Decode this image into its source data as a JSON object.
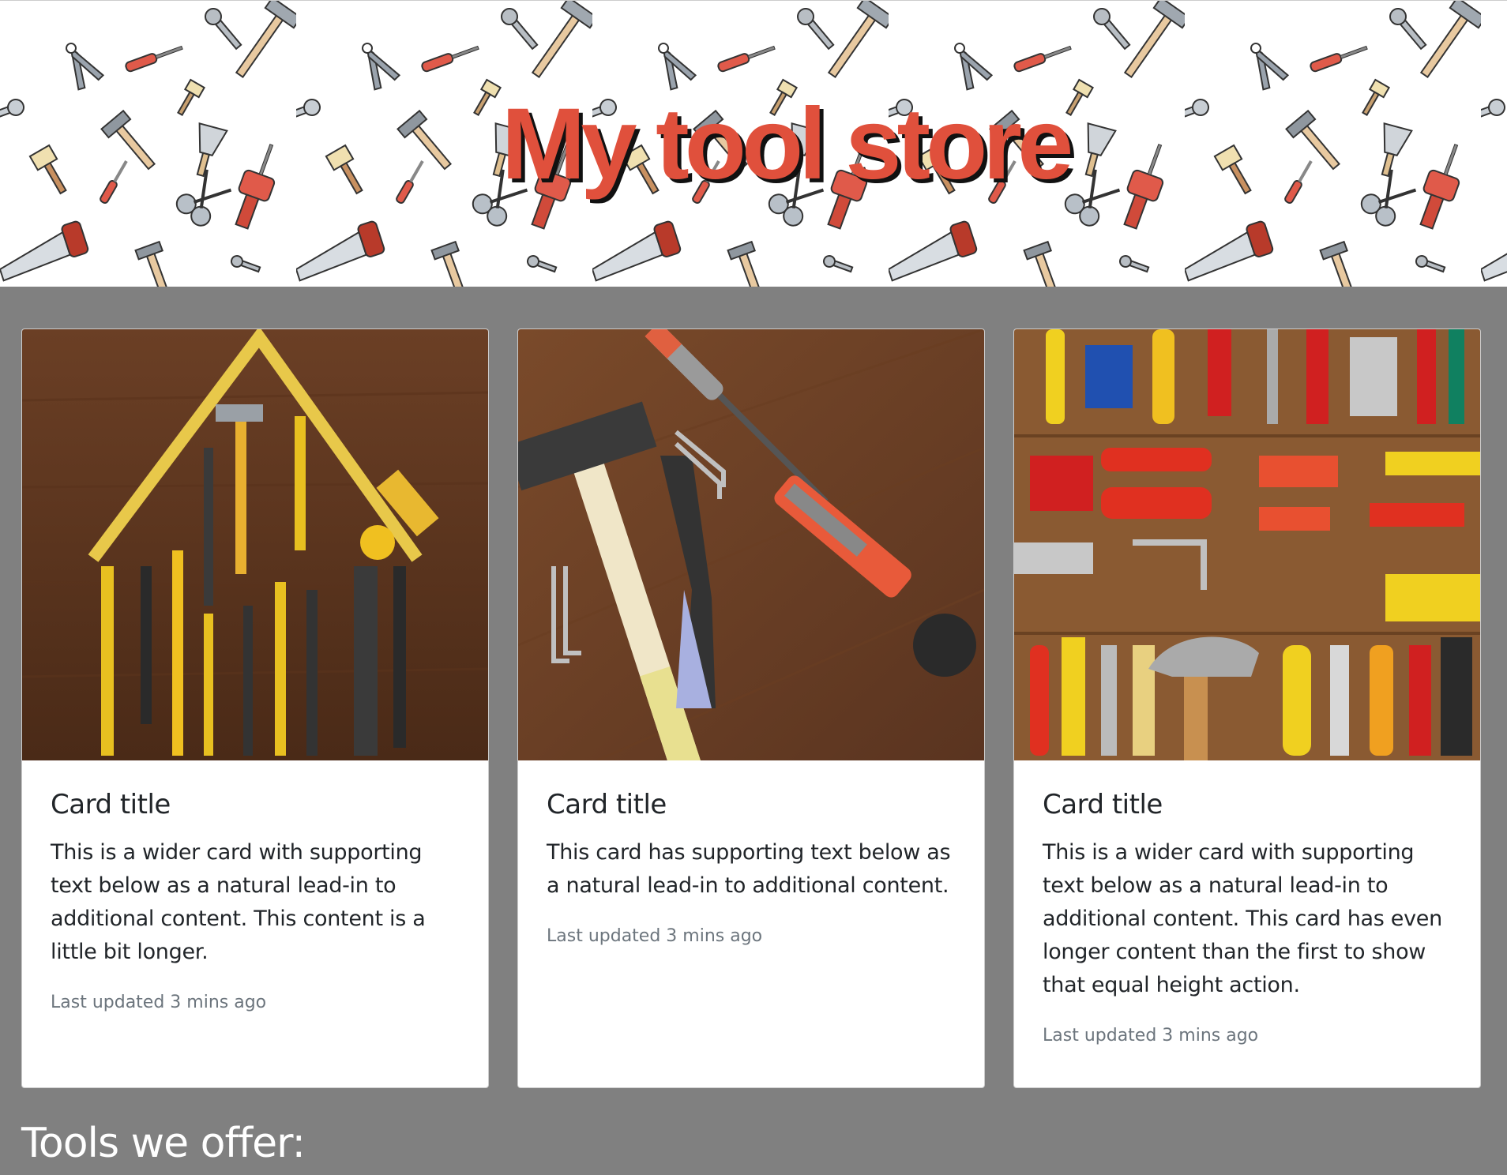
{
  "hero": {
    "title": "My tool store"
  },
  "cards": [
    {
      "image": "tools-arranged-as-house-photo",
      "title": "Card title",
      "text": "This is a wider card with supporting text below as a natural lead-in to additional content. This content is a little bit longer.",
      "updated": "Last updated 3 mins ago"
    },
    {
      "image": "hammer-pliers-screwdrivers-photo",
      "title": "Card title",
      "text": "This card has supporting text below as a natural lead-in to additional content.",
      "updated": "Last updated 3 mins ago"
    },
    {
      "image": "tool-collection-flatlay-photo",
      "title": "Card title",
      "text": "This is a wider card with supporting text below as a natural lead-in to additional content. This card has even longer content than the first to show that equal height action.",
      "updated": "Last updated 3 mins ago"
    }
  ],
  "section": {
    "title": "Tools we offer:"
  },
  "colors": {
    "page_bg": "#808080",
    "title_red": "#e0503c",
    "muted": "#6c757d"
  }
}
